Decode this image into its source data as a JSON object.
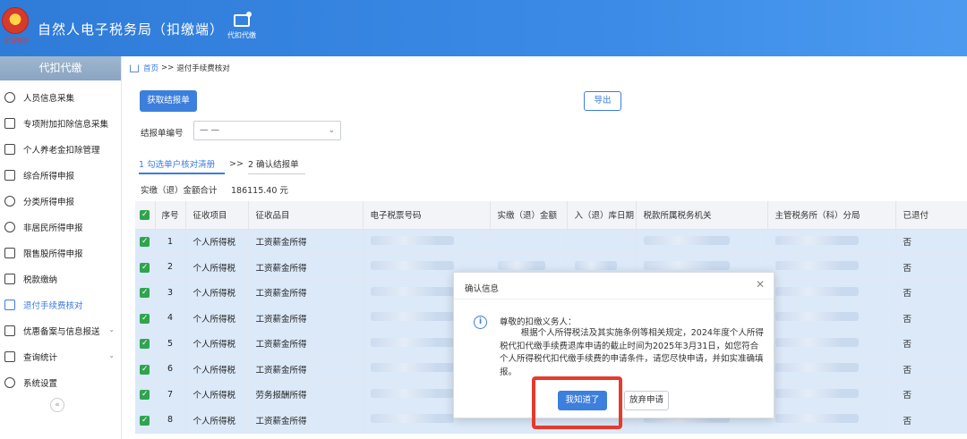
{
  "header": {
    "emblem_text": "中国税务",
    "title": "自然人电子税务局（扣缴端）",
    "top_tab_label": "代扣代缴"
  },
  "sidebar": {
    "section_title": "代扣代缴",
    "items": [
      {
        "label": "人员信息采集",
        "icon": "person-icon"
      },
      {
        "label": "专项附加扣除信息采集",
        "icon": "list-icon"
      },
      {
        "label": "个人养老金扣除管理",
        "icon": "document-icon"
      },
      {
        "label": "综合所得申报",
        "icon": "layers-icon"
      },
      {
        "label": "分类所得申报",
        "icon": "pie-chart-icon"
      },
      {
        "label": "非居民所得申报",
        "icon": "person-outline-icon"
      },
      {
        "label": "限售股所得申报",
        "icon": "bar-chart-icon"
      },
      {
        "label": "税款缴纳",
        "icon": "folder-icon"
      },
      {
        "label": "退付手续费核对",
        "icon": "checklist-icon",
        "active": true
      },
      {
        "label": "优惠备案与信息报送",
        "icon": "file-icon",
        "expandable": true
      },
      {
        "label": "查询统计",
        "icon": "search-chart-icon",
        "expandable": true
      },
      {
        "label": "系统设置",
        "icon": "gear-icon"
      }
    ],
    "collapse_glyph": "«"
  },
  "breadcrumb": {
    "home": "首页",
    "separator": ">>",
    "current": "退付手续费核对"
  },
  "buttons": {
    "fetch": "获取结报单",
    "export": "导出"
  },
  "form": {
    "report_no_label": "结报单编号",
    "report_no_value": "— —"
  },
  "steps": {
    "step1": "1 勾选单户核对清册",
    "separator": ">>",
    "step2": "2 确认结报单"
  },
  "total": {
    "label": "实缴（退）金额合计",
    "value": "186115.40 元"
  },
  "table": {
    "headers": [
      "序号",
      "征收项目",
      "征收品目",
      "电子税票号码",
      "实缴（退）金额",
      "入（退）库日期",
      "税款所属税务机关",
      "主管税务所（科）分局",
      "已退付"
    ],
    "rows": [
      {
        "no": "1",
        "item": "个人所得税",
        "sub": "工资薪金所得",
        "refunded": "否"
      },
      {
        "no": "2",
        "item": "个人所得税",
        "sub": "工资薪金所得",
        "refunded": "否"
      },
      {
        "no": "3",
        "item": "个人所得税",
        "sub": "工资薪金所得",
        "refunded": "否"
      },
      {
        "no": "4",
        "item": "个人所得税",
        "sub": "工资薪金所得",
        "refunded": "否"
      },
      {
        "no": "5",
        "item": "个人所得税",
        "sub": "工资薪金所得",
        "refunded": "否"
      },
      {
        "no": "6",
        "item": "个人所得税",
        "sub": "工资薪金所得",
        "refunded": "否"
      },
      {
        "no": "7",
        "item": "个人所得税",
        "sub": "劳务报酬所得",
        "refunded": "否"
      },
      {
        "no": "8",
        "item": "个人所得税",
        "sub": "工资薪金所得",
        "refunded": "否"
      }
    ]
  },
  "dialog": {
    "title": "确认信息",
    "greeting": "尊敬的扣缴义务人：",
    "body": "根据个人所得税法及其实施条例等相关规定，2024年度个人所得税代扣代缴手续费退库申请的截止时间为2025年3月31日，如您符合个人所得税代扣代缴手续费的申请条件，请您尽快申请，并如实准确填报。",
    "confirm": "我知道了",
    "abandon": "放弃申请"
  },
  "colors": {
    "header_blue": "#3a8ae6",
    "accent": "#3b7de0",
    "highlight_red": "#e53a2d",
    "checkbox_green": "#2fa44f"
  }
}
